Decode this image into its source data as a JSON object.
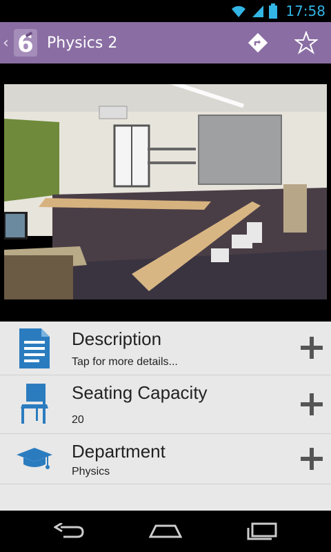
{
  "status_bar": {
    "time": "17:58"
  },
  "action_bar": {
    "title": "Physics 2",
    "colors": {
      "background": "#8a6ea3"
    },
    "logo_icon": "sixth-form-logo",
    "directions_icon": "directions-icon",
    "favorite_icon": "star-outline-icon"
  },
  "photo": {
    "subject": "classroom-photo"
  },
  "details": [
    {
      "title": "Description",
      "subtitle": "Tap for more details...",
      "icon": "document-icon"
    },
    {
      "title": "Seating Capacity",
      "subtitle": "20",
      "icon": "chair-icon"
    },
    {
      "title": "Department",
      "subtitle": "Physics",
      "icon": "graduation-cap-icon"
    }
  ],
  "nav_bar": {
    "back_icon": "back-icon",
    "home_icon": "home-icon",
    "recents_icon": "recents-icon"
  }
}
